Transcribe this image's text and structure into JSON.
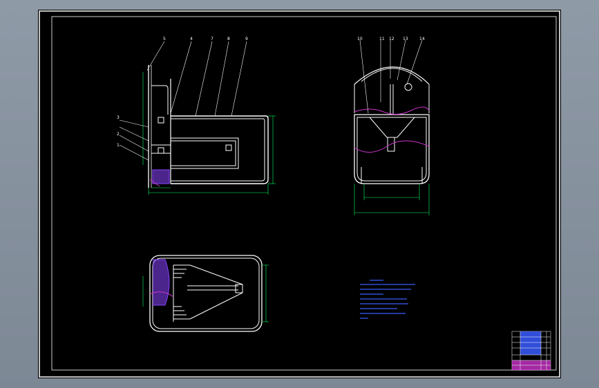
{
  "drawing": {
    "part_labels": [
      "5",
      "4",
      "7",
      "8",
      "9",
      "3",
      "2",
      "1",
      "10",
      "11",
      "12",
      "13",
      "14"
    ],
    "colors": {
      "background": "#000000",
      "frame": "#ffffff",
      "outline": "#ffffff",
      "dimension": "#00ff66",
      "accent": "#cc33cc",
      "note": "#3a5cff",
      "hatch": "#8844ff"
    }
  },
  "title_block": {
    "colors": {
      "header": "#3a5cff",
      "fill": "#cc33cc",
      "grid": "#ffffff"
    }
  }
}
